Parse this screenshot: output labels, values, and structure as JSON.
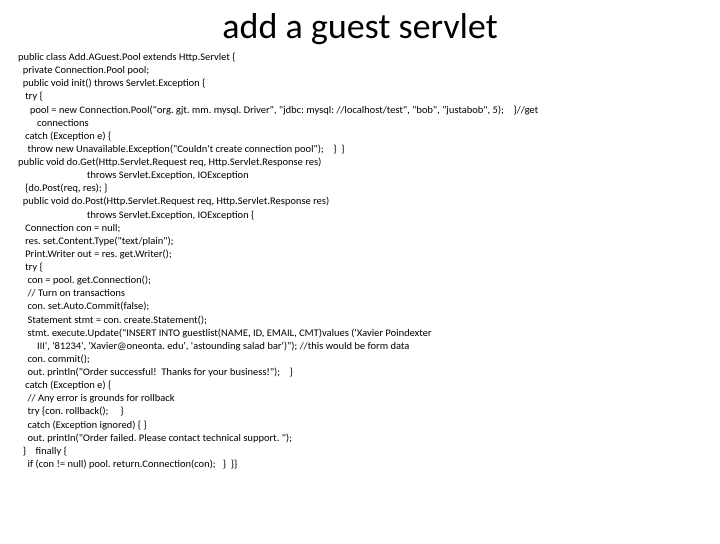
{
  "title": "add a guest servlet",
  "code_lines": [
    "public class Add.AGuest.Pool extends Http.Servlet {",
    "  private Connection.Pool pool;",
    "  public void init() throws Servlet.Exception {",
    "   try {",
    "     pool = new Connection.Pool(\"org. gjt. mm. mysql. Driver\", \"jdbc: mysql: //localhost/test\", \"bob\", \"justabob\", 5);    }//get",
    "        connections",
    "   catch (Exception e) {",
    "    throw new Unavailable.Exception(\"Couldn't create connection pool\");    }  }",
    "public void do.Get(Http.Servlet.Request req, Http.Servlet.Response res)",
    "                             throws Servlet.Exception, IOException",
    "   {do.Post(req, res); }",
    "  public void do.Post(Http.Servlet.Request req, Http.Servlet.Response res)",
    "                             throws Servlet.Exception, IOException {",
    "   Connection con = null;",
    "   res. set.Content.Type(\"text/plain\");",
    "   Print.Writer out = res. get.Writer();",
    "   try {",
    "    con = pool. get.Connection();",
    "    // Turn on transactions",
    "    con. set.Auto.Commit(false);",
    "    Statement stmt = con. create.Statement();",
    "    stmt. execute.Update(\"INSERT INTO guestlist(NAME, ID, EMAIL, CMT)values ('Xavier Poindexter",
    "        III', '81234', 'Xavier@oneonta. edu', 'astounding salad bar')\"); //this would be form data",
    "    con. commit();",
    "    out. println(\"Order successful!  Thanks for your business!\");    }",
    "   catch (Exception e) {",
    "    // Any error is grounds for rollback",
    "    try {con. rollback();     }",
    "    catch (Exception ignored) { }",
    "    out. println(\"Order failed. Please contact technical support. \");",
    "  }    finally {",
    "    if (con != null) pool. return.Connection(con);   }  }}"
  ]
}
